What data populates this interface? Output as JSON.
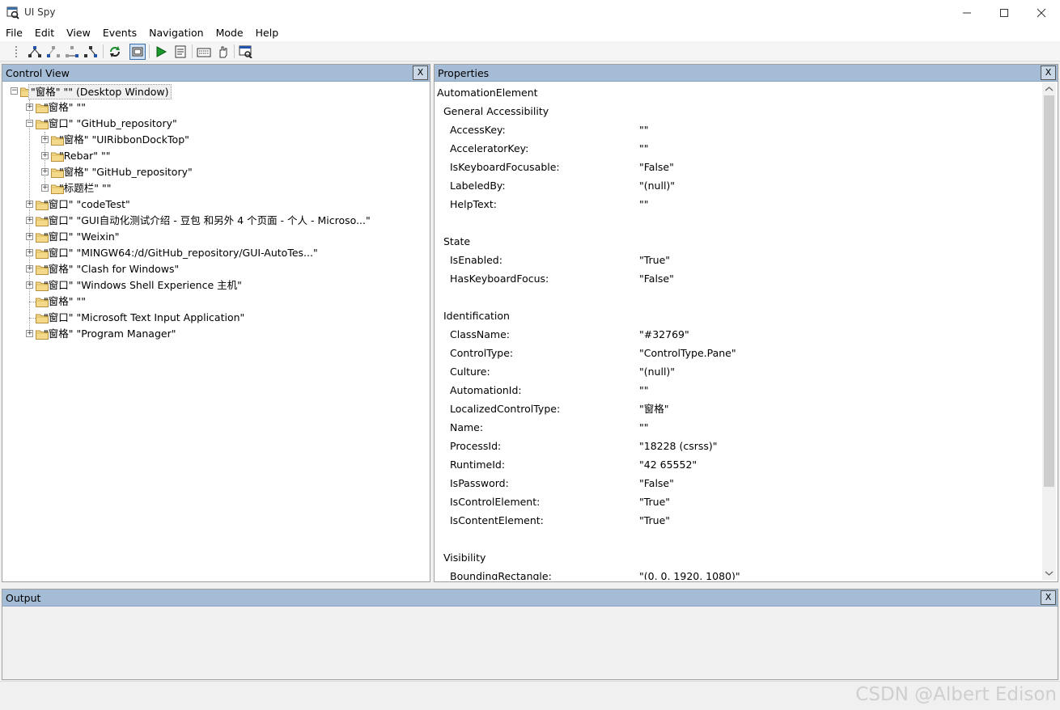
{
  "window": {
    "title": "UI Spy",
    "menu": [
      "File",
      "Edit",
      "View",
      "Events",
      "Navigation",
      "Mode",
      "Help"
    ]
  },
  "toolbar": {
    "icons": [
      "grip-icon",
      "parent-icon",
      "first-child-icon",
      "next-sibling-icon",
      "last-child-icon",
      "refresh-icon",
      "highlight-rectangle-icon",
      "play-icon",
      "properties-icon",
      "keyboard-icon",
      "hand-icon",
      "find-window-icon"
    ]
  },
  "control_view": {
    "title": "Control View",
    "close": "X",
    "tree": [
      {
        "label": "\"窗格\" \"\" (Desktop Window)",
        "level": 0,
        "expander": "minus"
      },
      {
        "label": "\"窗格\" \"\"",
        "level": 1,
        "expander": "plus"
      },
      {
        "label": "\"窗口\" \"GitHub_repository\"",
        "level": 1,
        "expander": "minus"
      },
      {
        "label": "\"窗格\" \"UIRibbonDockTop\"",
        "level": 2,
        "expander": "plus"
      },
      {
        "label": "\"Rebar\" \"\"",
        "level": 2,
        "expander": "plus"
      },
      {
        "label": "\"窗格\" \"GitHub_repository\"",
        "level": 2,
        "expander": "plus"
      },
      {
        "label": "\"标题栏\" \"\"",
        "level": 2,
        "expander": "plus"
      },
      {
        "label": "\"窗口\" \"codeTest\"",
        "level": 1,
        "expander": "plus"
      },
      {
        "label": "\"窗口\" \"GUI自动化测试介绍 - 豆包 和另外 4 个页面 - 个人 - Microso...\"",
        "level": 1,
        "expander": "plus"
      },
      {
        "label": "\"窗口\" \"Weixin\"",
        "level": 1,
        "expander": "plus"
      },
      {
        "label": "\"窗口\" \"MINGW64:/d/GitHub_repository/GUI-AutoTes...\"",
        "level": 1,
        "expander": "plus"
      },
      {
        "label": "\"窗格\" \"Clash for Windows\"",
        "level": 1,
        "expander": "plus"
      },
      {
        "label": "\"窗口\" \"Windows Shell Experience 主机\"",
        "level": 1,
        "expander": "plus"
      },
      {
        "label": "\"窗格\" \"\"",
        "level": 1,
        "expander": "none"
      },
      {
        "label": "\"窗口\" \"Microsoft Text Input Application\"",
        "level": 1,
        "expander": "none"
      },
      {
        "label": "\"窗格\" \"Program Manager\"",
        "level": 1,
        "expander": "plus"
      }
    ]
  },
  "properties": {
    "title": "Properties",
    "close": "X",
    "root": "AutomationElement",
    "sections": [
      {
        "name": "General Accessibility",
        "items": [
          {
            "name": "AccessKey:",
            "value": "\"\""
          },
          {
            "name": "AcceleratorKey:",
            "value": "\"\""
          },
          {
            "name": "IsKeyboardFocusable:",
            "value": "\"False\""
          },
          {
            "name": "LabeledBy:",
            "value": "\"(null)\""
          },
          {
            "name": "HelpText:",
            "value": "\"\""
          }
        ]
      },
      {
        "name": "State",
        "items": [
          {
            "name": "IsEnabled:",
            "value": "\"True\""
          },
          {
            "name": "HasKeyboardFocus:",
            "value": "\"False\""
          }
        ]
      },
      {
        "name": "Identification",
        "items": [
          {
            "name": "ClassName:",
            "value": "\"#32769\""
          },
          {
            "name": "ControlType:",
            "value": "\"ControlType.Pane\""
          },
          {
            "name": "Culture:",
            "value": "\"(null)\""
          },
          {
            "name": "AutomationId:",
            "value": "\"\""
          },
          {
            "name": "LocalizedControlType:",
            "value": "\"窗格\""
          },
          {
            "name": "Name:",
            "value": "\"\""
          },
          {
            "name": "ProcessId:",
            "value": "\"18228 (csrss)\""
          },
          {
            "name": "RuntimeId:",
            "value": "\"42 65552\""
          },
          {
            "name": "IsPassword:",
            "value": "\"False\""
          },
          {
            "name": "IsControlElement:",
            "value": "\"True\""
          },
          {
            "name": "IsContentElement:",
            "value": "\"True\""
          }
        ]
      },
      {
        "name": "Visibility",
        "items": [
          {
            "name": "BoundingRectangle:",
            "value": "\"(0, 0, 1920, 1080)\""
          }
        ]
      }
    ]
  },
  "output": {
    "title": "Output",
    "close": "X"
  },
  "watermark": "CSDN @Albert Edison"
}
